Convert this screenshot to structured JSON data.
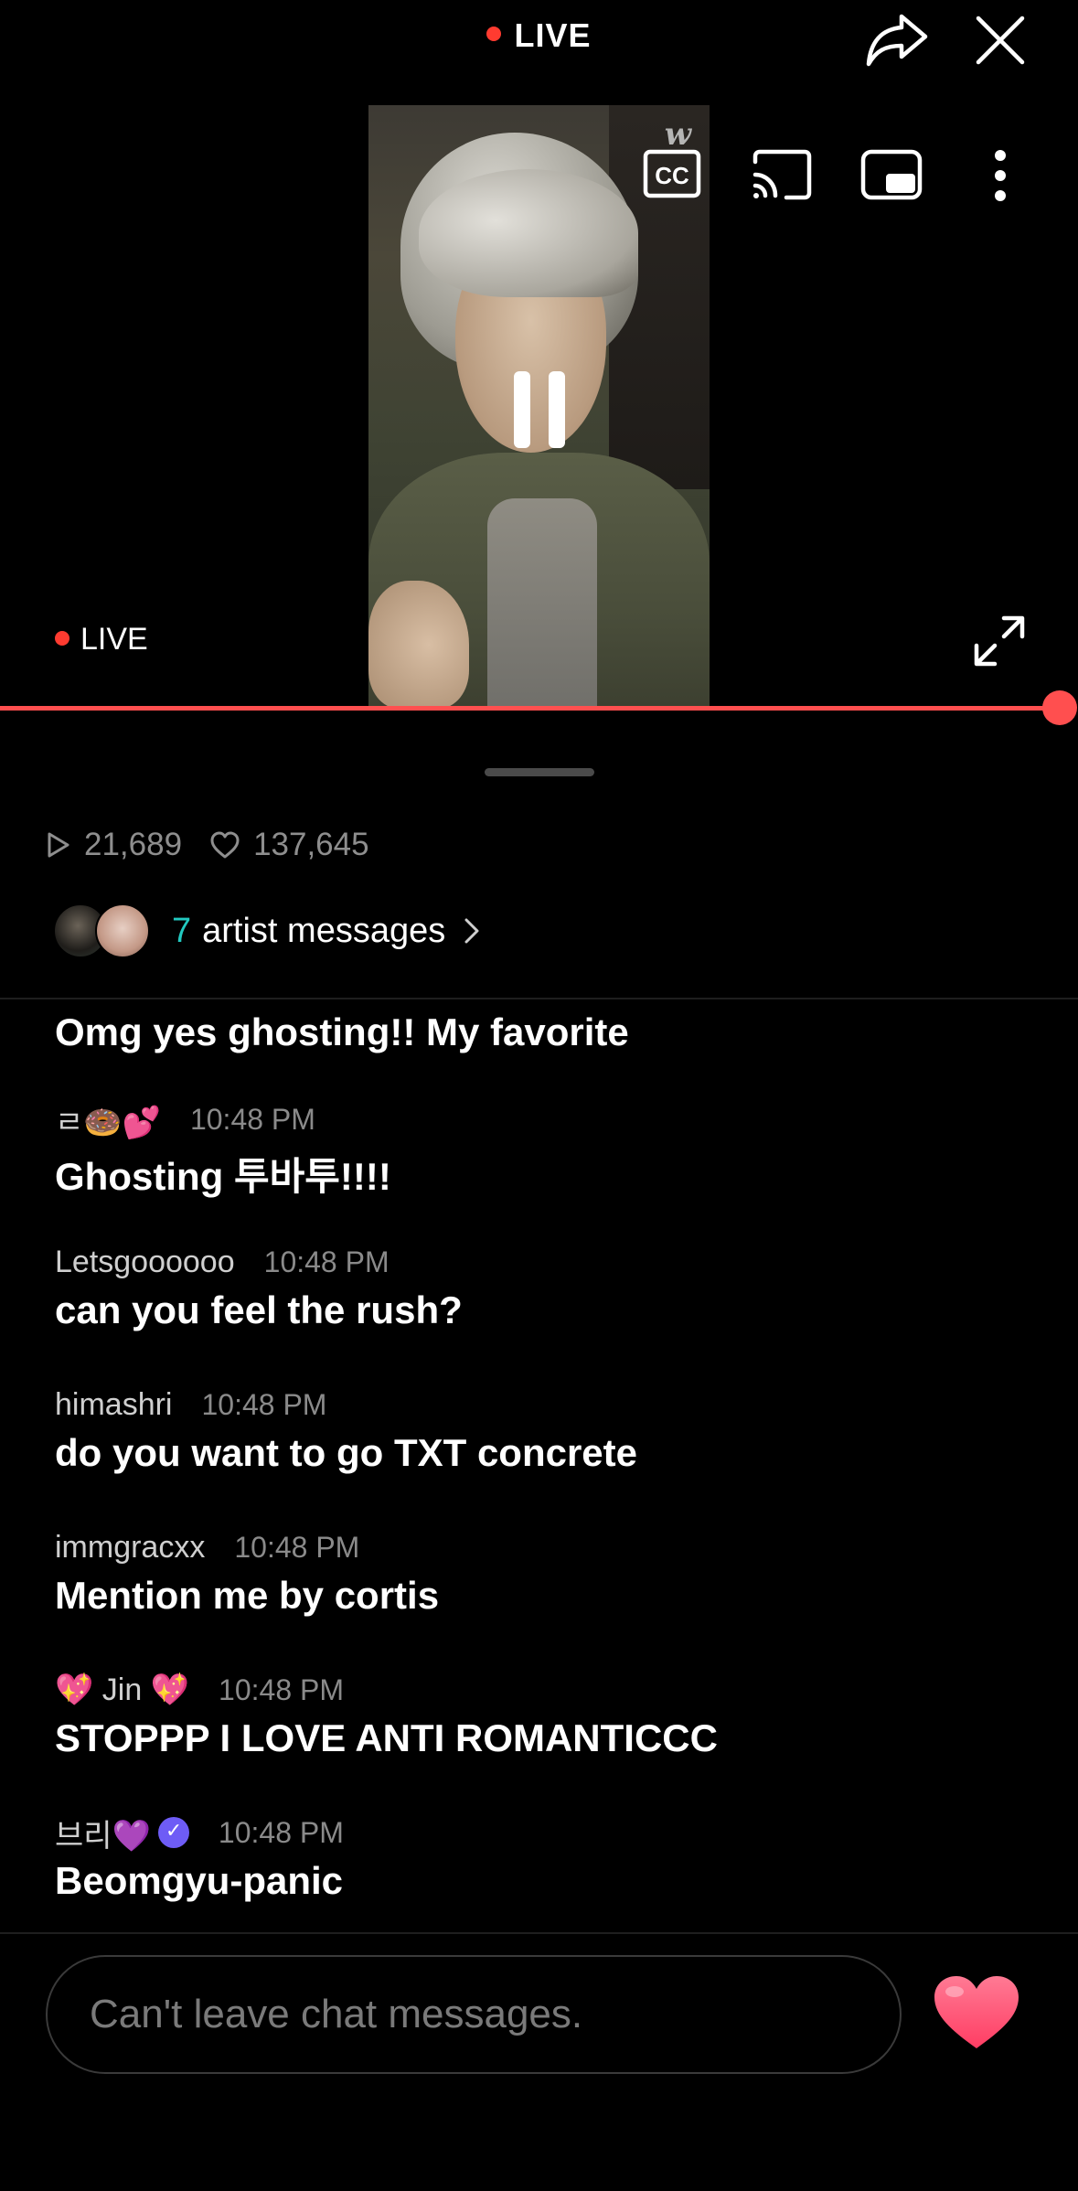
{
  "header": {
    "live_label": "LIVE"
  },
  "player": {
    "live_badge": "LIVE",
    "watermark": "w",
    "progress_fraction": 1.0
  },
  "stats": {
    "plays": "21,689",
    "likes": "137,645"
  },
  "artist_messages": {
    "count": "7",
    "label": "artist messages"
  },
  "chat": {
    "messages": [
      {
        "name": "",
        "time": "",
        "text": "Omg yes ghosting!! My favorite"
      },
      {
        "name": "ㄹ🍩💕",
        "time": "10:48 PM",
        "text": "Ghosting 투바투!!!!"
      },
      {
        "name": "Letsgoooooo",
        "time": "10:48 PM",
        "text": "can you feel the rush?"
      },
      {
        "name": "himashri",
        "time": "10:48 PM",
        "text": "do you want to go TXT concrete"
      },
      {
        "name": "immgracxx",
        "time": "10:48 PM",
        "text": "Mention me by cortis"
      },
      {
        "name": "💖 Jin 💖",
        "time": "10:48 PM",
        "text": "STOPPP I LOVE ANTI ROMANTICCC"
      },
      {
        "name": "브리💜",
        "time": "10:48 PM",
        "text": "Beomgyu-panic"
      }
    ]
  },
  "composer": {
    "placeholder": "Can't leave chat messages."
  },
  "colors": {
    "live_red": "#ff3b30",
    "progress": "#ff4f4f",
    "accent_teal": "#22c9c0",
    "heart": "#ff4d6d"
  },
  "icons": [
    "share-icon",
    "close-icon",
    "cc-icon",
    "cast-icon",
    "pip-icon",
    "more-icon",
    "pause-icon",
    "expand-icon",
    "play-icon",
    "heart-outline-icon",
    "chevron-right-icon",
    "heart-icon"
  ]
}
